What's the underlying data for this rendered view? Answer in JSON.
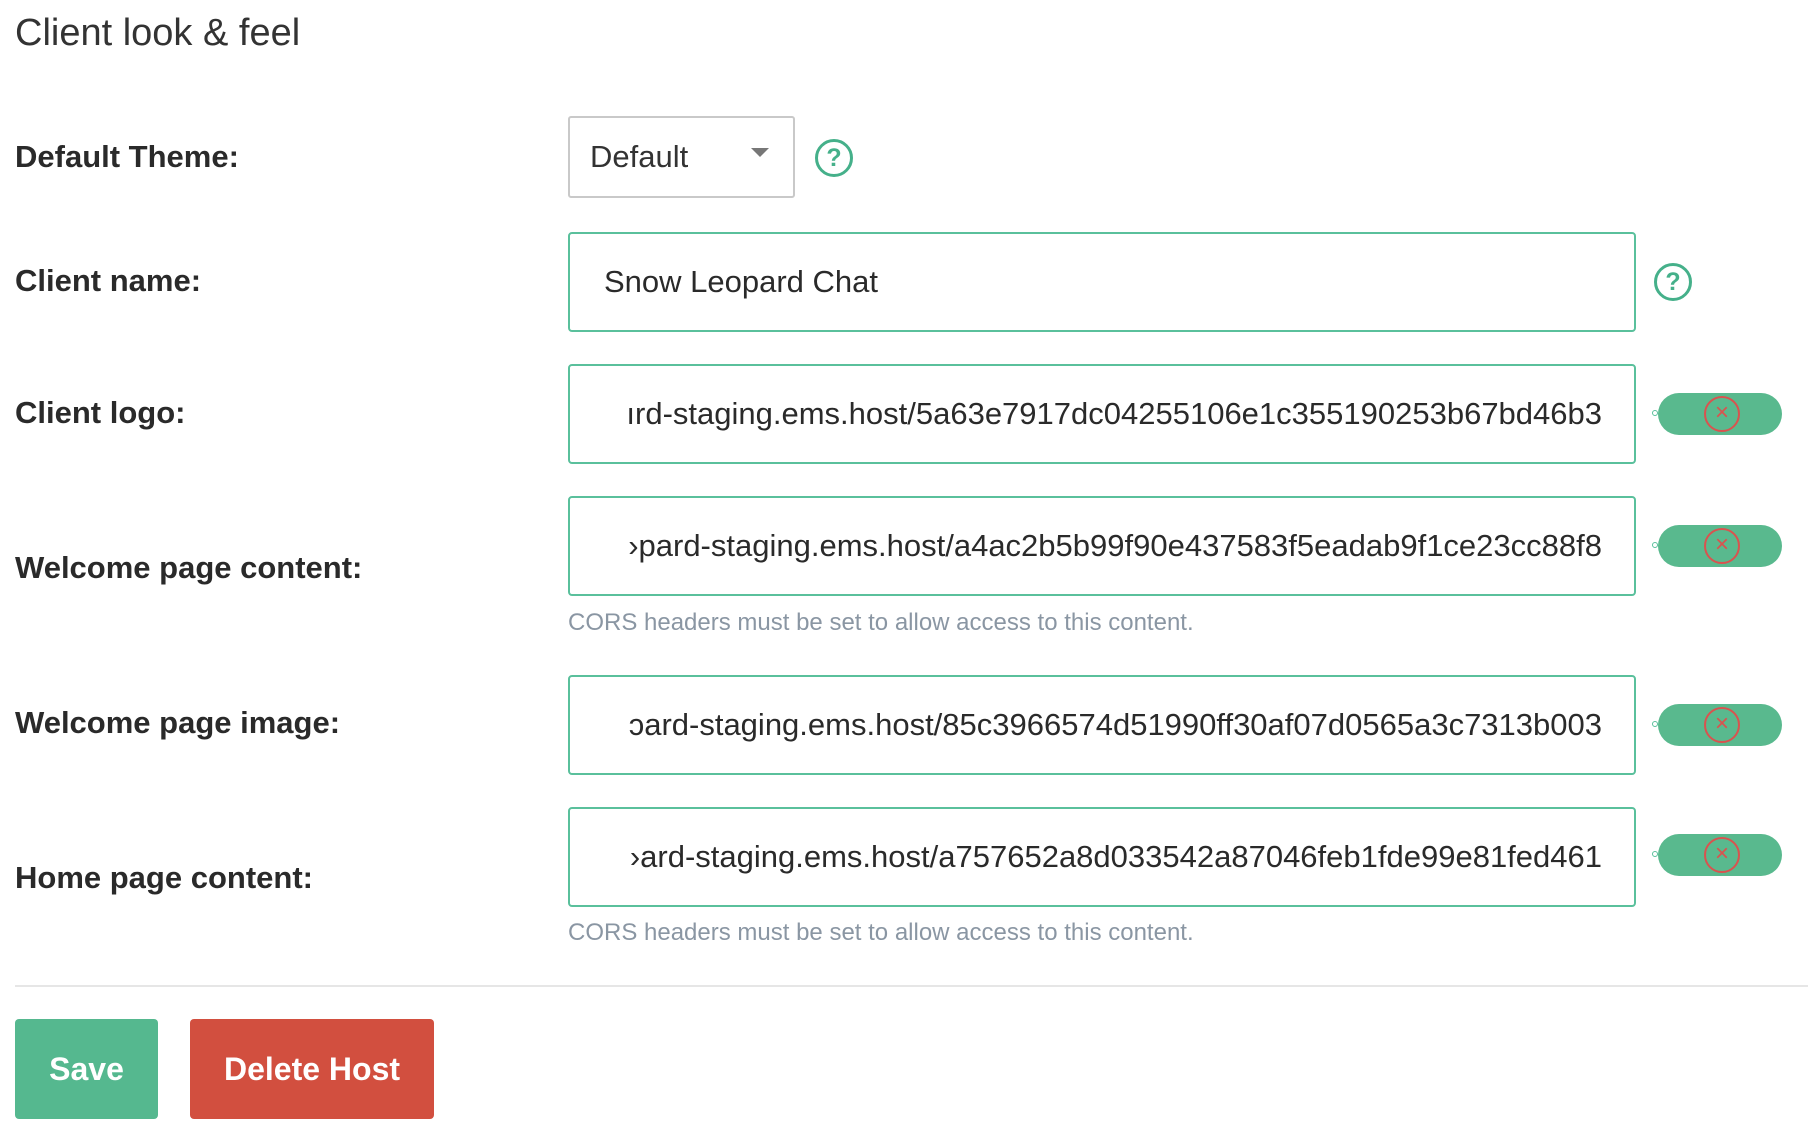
{
  "page": {
    "title": "Client look & feel"
  },
  "fields": {
    "default_theme": {
      "label": "Default Theme:",
      "selected": "Default",
      "help": "?"
    },
    "client_name": {
      "label": "Client name:",
      "value": "Snow Leopard Chat",
      "help": "?"
    },
    "client_logo": {
      "label": "Client logo:",
      "value": "ırd-staging.ems.host/5a63e7917dc04255106e1c355190253b67bd46b3"
    },
    "welcome_page_content": {
      "label": "Welcome page content:",
      "value": "›pard-staging.ems.host/a4ac2b5b99f90e437583f5eadab9f1ce23cc88f8",
      "hint": "CORS headers must be set to allow access to this content."
    },
    "welcome_page_image": {
      "label": "Welcome page image:",
      "value": "ɔard-staging.ems.host/85c3966574d51990ff30af07d0565a3c7313b003"
    },
    "home_page_content": {
      "label": "Home page content:",
      "value": "›ard-staging.ems.host/a757652a8d033542a87046feb1fde99e81fed461",
      "hint": "CORS headers must be set to allow access to this content."
    }
  },
  "icons": {
    "help": "help-circle-icon",
    "clear": "close-circle-icon",
    "clear_glyph": "×"
  },
  "actions": {
    "save_label": "Save",
    "delete_label": "Delete Host"
  },
  "colors": {
    "accent_green": "#55b88f",
    "input_border": "#5ac09c",
    "danger_red": "#d24f3f",
    "hint_gray": "#8a96a3"
  }
}
